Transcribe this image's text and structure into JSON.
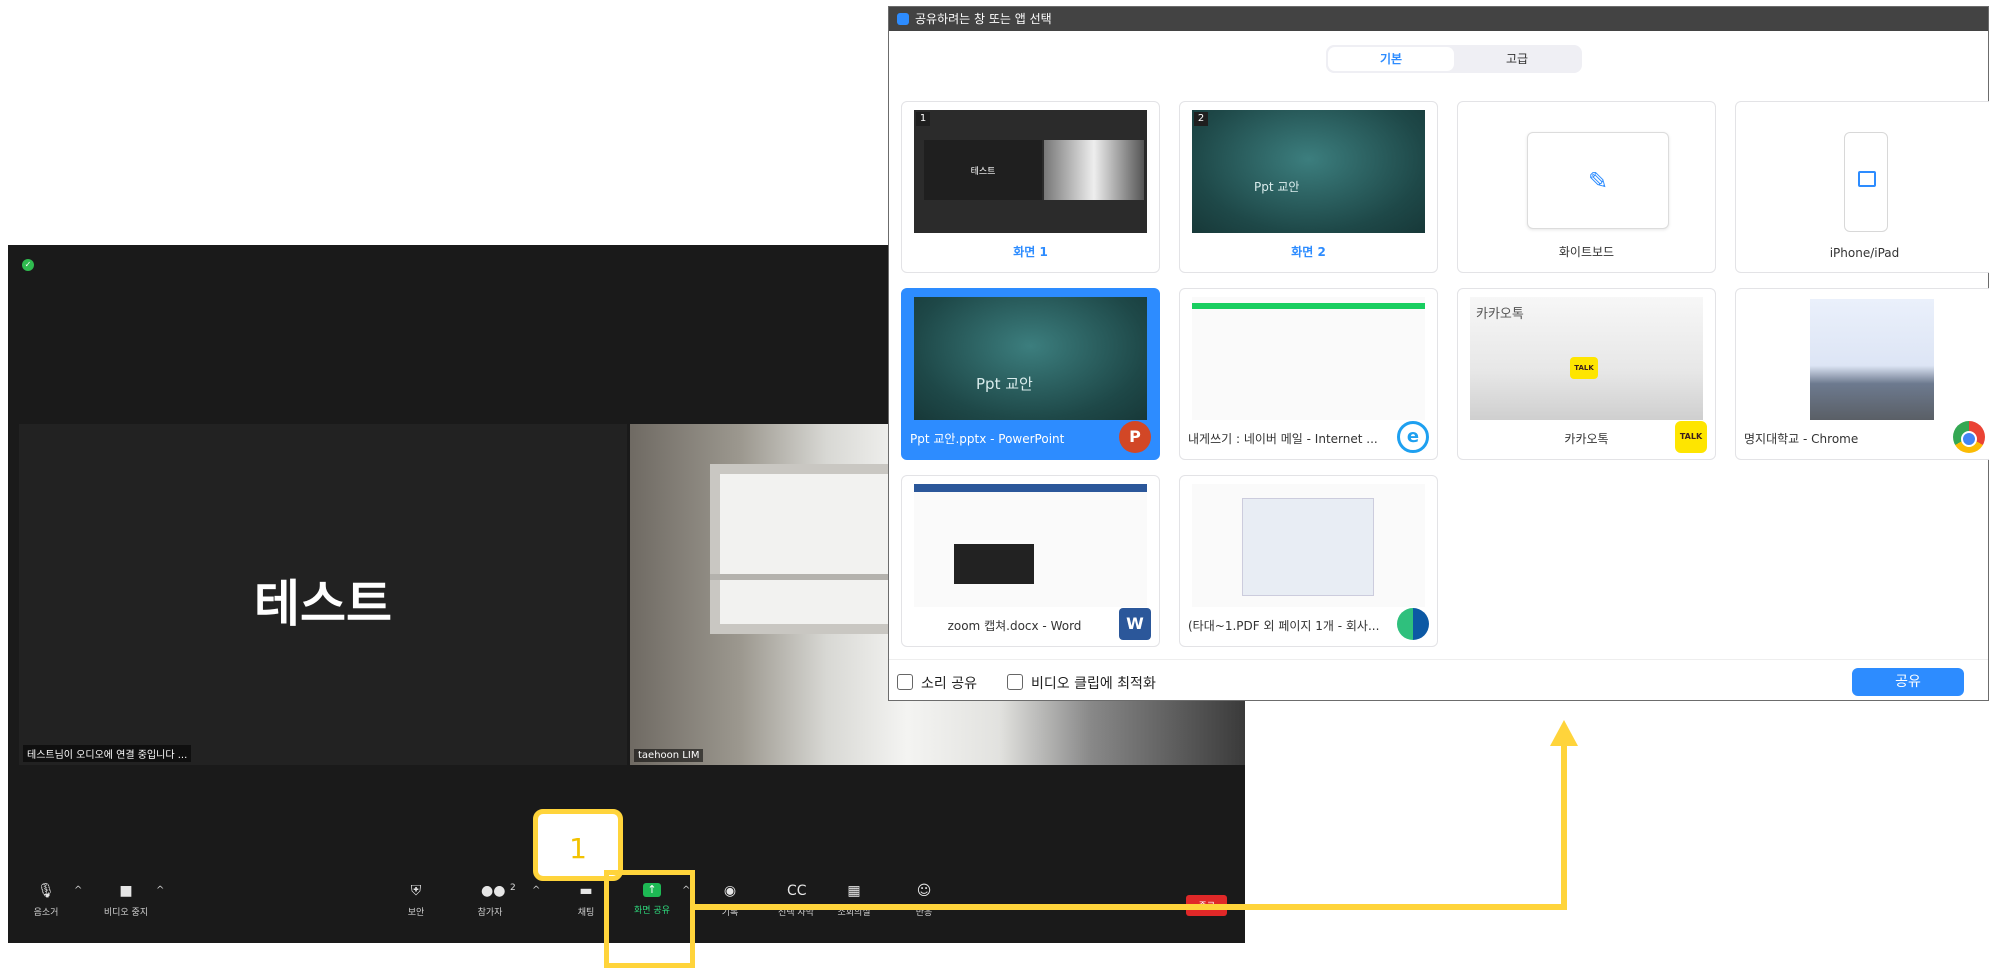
{
  "zoom_window": {
    "left_tile": {
      "name": "테스트",
      "caption": "테스트님이 오디오에 연결 중입니다 ..."
    },
    "right_tile": {
      "caption": "taehoon LIM"
    },
    "toolbar": {
      "mute": "음소거",
      "stop_video": "비디오 중지",
      "security": "보안",
      "participants": "참가자",
      "participants_count": "2",
      "chat": "채팅",
      "share_screen": "화면 공유",
      "record": "기록",
      "subtitles": "선택 자막",
      "breakout": "소회의실",
      "reactions": "반응",
      "end": "종료"
    }
  },
  "share_dialog": {
    "title": "공유하려는 창 또는 앱 선택",
    "tabs": [
      "기본",
      "고급"
    ],
    "cards": [
      {
        "label": "화면 1",
        "num": "1",
        "thumb_text": "테스트"
      },
      {
        "label": "화면 2",
        "num": "2",
        "thumb_text": "Ppt 교안"
      },
      {
        "label": "화이트보드"
      },
      {
        "label": "iPhone/iPad"
      },
      {
        "label": "Ppt 교안.pptx - PowerPoint",
        "thumb_text": "Ppt 교안",
        "app_icon": "P"
      },
      {
        "label": "내게쓰기 : 네이버 메일 - Internet ...",
        "app_icon": "e"
      },
      {
        "label": "카카오톡",
        "thumb_text": "카카오톡",
        "app_icon": "TALK"
      },
      {
        "label": "명지대학교 - Chrome"
      },
      {
        "label": "zoom 캡쳐.docx - Word",
        "app_icon": "W"
      },
      {
        "label": "(타대~1.PDF 외 페이지 1개 - 회사..."
      }
    ],
    "footer": {
      "share_sound": "소리 공유",
      "optimize_video": "비디오 클립에 최적화",
      "share_button": "공유"
    }
  },
  "annotation": {
    "step_number": "1",
    "color": "#ffd43b"
  }
}
